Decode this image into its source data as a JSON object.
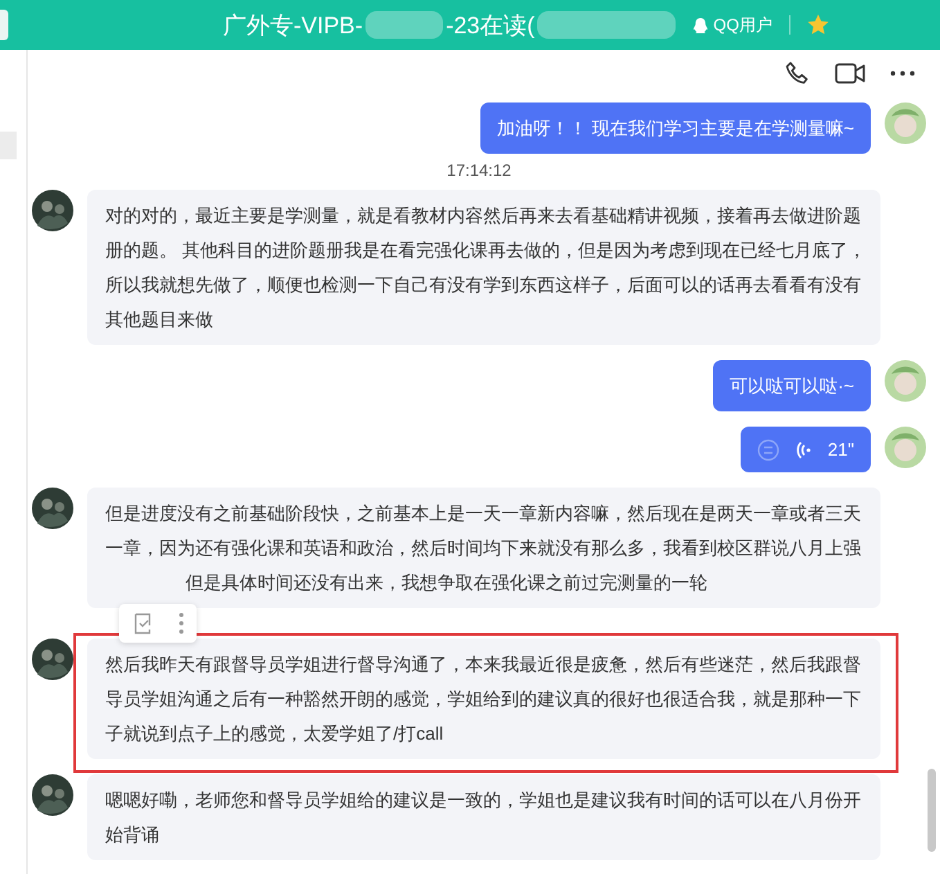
{
  "header": {
    "title_parts": [
      "广外专-VIPB-",
      "-23在读("
    ],
    "user_label": "QQ用户"
  },
  "messages": [
    {
      "kind": "out",
      "text": "加油呀！！ 现在我们学习主要是在学测量嘛~"
    },
    {
      "kind": "time",
      "text": "17:14:12"
    },
    {
      "kind": "in",
      "highlighted": false,
      "text": "对的对的，最近主要是学测量，就是看教材内容然后再来去看基础精讲视频，接着再去做进阶题册的题。   其他科目的进阶题册我是在看完强化课再去做的，但是因为考虑到现在已经七月底了，所以我就想先做了，顺便也检测一下自己有没有学到东西这样子，后面可以的话再去看看有没有其他题目来做"
    },
    {
      "kind": "out",
      "text": "可以哒可以哒·~"
    },
    {
      "kind": "voice",
      "duration": "21\""
    },
    {
      "kind": "in",
      "highlighted": false,
      "text": "但是进度没有之前基础阶段快，之前基本上是一天一章新内容嘛，然后现在是两天一章或者三天一章，因为还有强化课和英语和政治，然后时间均下来就没有那么多，我看到校区群说八月上强",
      "tail": "但是具体时间还没有出来，我想争取在强化课之前过完测量的一轮"
    },
    {
      "kind": "in",
      "highlighted": true,
      "text": "然后我昨天有跟督导员学姐进行督导沟通了，本来我最近很是疲惫，然后有些迷茫，然后我跟督导员学姐沟通之后有一种豁然开朗的感觉，学姐给到的建议真的很好也很适合我，就是那种一下子就说到点子上的感觉，太爱学姐了/打call"
    },
    {
      "kind": "in",
      "highlighted": false,
      "text": "嗯嗯好嘞，老师您和督导员学姐给的建议是一致的，学姐也是建议我有时间的话可以在八月份开始背诵"
    }
  ]
}
